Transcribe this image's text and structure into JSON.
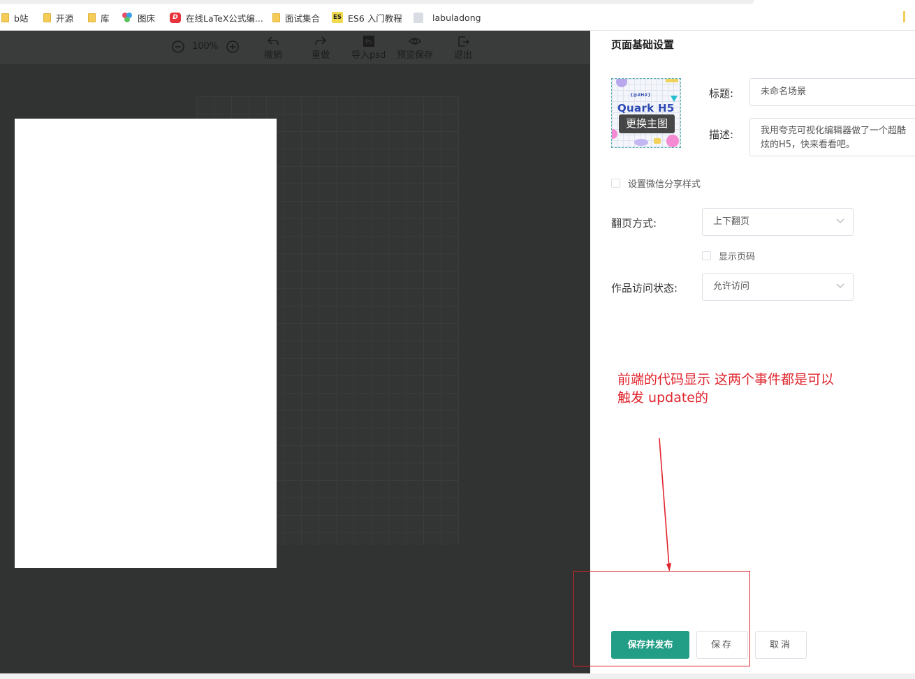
{
  "bookmarks": [
    {
      "label": "b站",
      "icon": "folder-icon"
    },
    {
      "label": "开源",
      "icon": "folder-icon"
    },
    {
      "label": "库",
      "icon": "folder-icon"
    },
    {
      "label": "图床",
      "icon": "color-circles-icon"
    },
    {
      "label": "在线LaTeX公式编...",
      "icon": "latex-icon"
    },
    {
      "label": "面试集合",
      "icon": "folder-icon"
    },
    {
      "label": "ES6 入门教程",
      "icon": "es-icon"
    },
    {
      "label": "labuladong",
      "icon": "doc-icon"
    }
  ],
  "toolbar": {
    "zoom": "100%",
    "undo": "撤销",
    "redo": "重做",
    "import_psd": "导入psd",
    "preview_save": "预览保存",
    "exit": "退出"
  },
  "panel": {
    "title": "页面基础设置",
    "thumb_text": "Quark H5",
    "thumb_top_text": "{@#H#}",
    "change_image": "更换主图",
    "title_label": "标题:",
    "title_value": "未命名场景",
    "desc_label": "描述:",
    "desc_value": "我用夸克可视化编辑器做了一个超酷炫的H5，快来看看吧。",
    "wechat_share": "设置微信分享样式",
    "page_turn_label": "翻页方式:",
    "page_turn_value": "上下翻页",
    "show_page_number": "显示页码",
    "access_label": "作品访问状态:",
    "access_value": "允许访问"
  },
  "annotation": {
    "line1": "前端的代码显示  这两个事件都是可以",
    "line2": "触发  update的",
    "color": "#e0242d"
  },
  "buttons": {
    "save_publish": "保存并发布",
    "save": "保存",
    "cancel": "取消"
  },
  "colors": {
    "primary": "#239e86",
    "editor_bg": "#313232"
  }
}
